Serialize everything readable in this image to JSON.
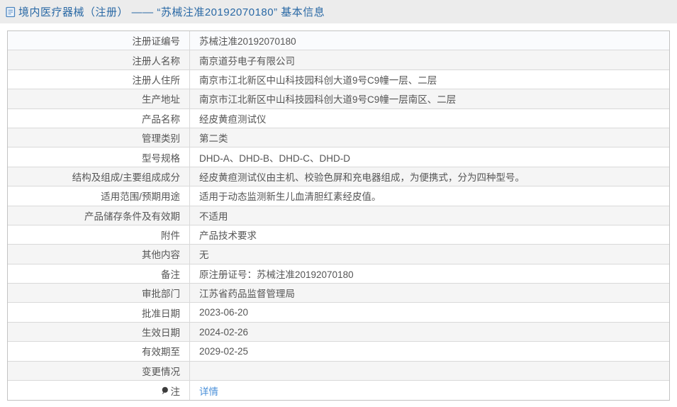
{
  "header": {
    "icon": "document-icon",
    "title": "境内医疗器械（注册） —— “苏械注准20192070180” 基本信息"
  },
  "table": {
    "rows": [
      {
        "label": "注册证编号",
        "value": "苏械注准20192070180"
      },
      {
        "label": "注册人名称",
        "value": "南京道芬电子有限公司"
      },
      {
        "label": "注册人住所",
        "value": "南京市江北新区中山科技园科创大道9号C9幢一层、二层"
      },
      {
        "label": "生产地址",
        "value": "南京市江北新区中山科技园科创大道9号C9幢一层南区、二层"
      },
      {
        "label": "产品名称",
        "value": "经皮黄疸测试仪"
      },
      {
        "label": "管理类别",
        "value": "第二类"
      },
      {
        "label": "型号规格",
        "value": "DHD-A、DHD-B、DHD-C、DHD-D"
      },
      {
        "label": "结构及组成/主要组成成分",
        "value": "经皮黄疸测试仪由主机、校验色屏和充电器组成，为便携式，分为四种型号。"
      },
      {
        "label": "适用范围/预期用途",
        "value": "适用于动态监测新生儿血清胆红素经皮值。"
      },
      {
        "label": "产品储存条件及有效期",
        "value": "不适用"
      },
      {
        "label": "附件",
        "value": "产品技术要求"
      },
      {
        "label": "其他内容",
        "value": "无"
      },
      {
        "label": "备注",
        "value": "原注册证号：苏械注准20192070180"
      },
      {
        "label": "审批部门",
        "value": "江苏省药品监督管理局"
      },
      {
        "label": "批准日期",
        "value": "2023-06-20"
      },
      {
        "label": "生效日期",
        "value": "2024-02-26"
      },
      {
        "label": "有效期至",
        "value": "2029-02-25"
      },
      {
        "label": "变更情况",
        "value": ""
      },
      {
        "label": "注",
        "value": "详情",
        "link": true,
        "icon": "note-icon"
      }
    ]
  },
  "colors": {
    "header_text": "#2a69a5",
    "link": "#4a90d9",
    "topbar_bg": "#ececec",
    "row_alt_bg": "#f5f5f5",
    "first_row_bg": "#fafbfd",
    "border": "#c3c3c3",
    "text": "#555555"
  }
}
